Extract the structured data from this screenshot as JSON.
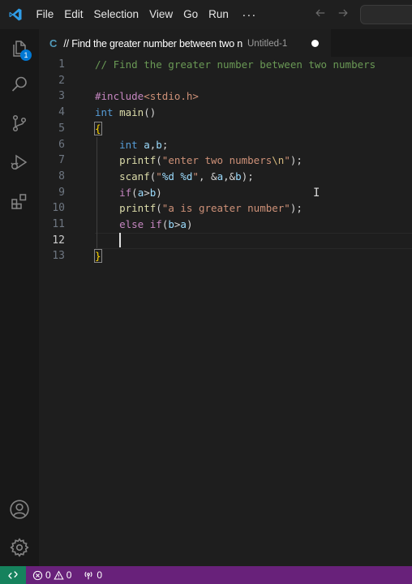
{
  "menu": {
    "items": [
      "File",
      "Edit",
      "Selection",
      "View",
      "Go",
      "Run"
    ],
    "more": "···"
  },
  "activity": {
    "explorer_badge": "1"
  },
  "tab": {
    "lang": "C",
    "title": "// Find the greater number between two n",
    "description": "Untitled-1"
  },
  "editor": {
    "line_numbers": [
      "1",
      "2",
      "3",
      "4",
      "5",
      "6",
      "7",
      "8",
      "9",
      "10",
      "11",
      "12",
      "13"
    ],
    "active_line": 12,
    "lines": [
      [
        {
          "t": "// Find the greater number between two numbers",
          "c": "t-comment"
        }
      ],
      [],
      [
        {
          "t": "#include",
          "c": "t-pre"
        },
        {
          "t": "<stdio.h>",
          "c": "t-inc"
        }
      ],
      [
        {
          "t": "int",
          "c": "t-kw"
        },
        {
          "t": " ",
          "c": "t-plain"
        },
        {
          "t": "main",
          "c": "t-fn"
        },
        {
          "t": "()",
          "c": "t-plain"
        }
      ],
      [
        {
          "t": "{",
          "c": "t-brace t-brace-box"
        }
      ],
      [
        {
          "t": "    ",
          "c": "t-plain"
        },
        {
          "t": "int",
          "c": "t-kw"
        },
        {
          "t": " ",
          "c": "t-plain"
        },
        {
          "t": "a",
          "c": "t-var"
        },
        {
          "t": ",",
          "c": "t-plain"
        },
        {
          "t": "b",
          "c": "t-var"
        },
        {
          "t": ";",
          "c": "t-plain"
        }
      ],
      [
        {
          "t": "    ",
          "c": "t-plain"
        },
        {
          "t": "printf",
          "c": "t-fn"
        },
        {
          "t": "(",
          "c": "t-plain"
        },
        {
          "t": "\"enter two numbers",
          "c": "t-str"
        },
        {
          "t": "\\n",
          "c": "t-esc"
        },
        {
          "t": "\"",
          "c": "t-str"
        },
        {
          "t": ");",
          "c": "t-plain"
        }
      ],
      [
        {
          "t": "    ",
          "c": "t-plain"
        },
        {
          "t": "scanf",
          "c": "t-fn"
        },
        {
          "t": "(",
          "c": "t-plain"
        },
        {
          "t": "\"",
          "c": "t-str"
        },
        {
          "t": "%d %d",
          "c": "t-var"
        },
        {
          "t": "\"",
          "c": "t-str"
        },
        {
          "t": ", &",
          "c": "t-plain"
        },
        {
          "t": "a",
          "c": "t-var"
        },
        {
          "t": ",&",
          "c": "t-plain"
        },
        {
          "t": "b",
          "c": "t-var"
        },
        {
          "t": ");",
          "c": "t-plain"
        }
      ],
      [
        {
          "t": "    ",
          "c": "t-plain"
        },
        {
          "t": "if",
          "c": "t-ctrl"
        },
        {
          "t": "(",
          "c": "t-plain"
        },
        {
          "t": "a",
          "c": "t-var"
        },
        {
          "t": ">",
          "c": "t-plain"
        },
        {
          "t": "b",
          "c": "t-var"
        },
        {
          "t": ")",
          "c": "t-plain"
        }
      ],
      [
        {
          "t": "    ",
          "c": "t-plain"
        },
        {
          "t": "printf",
          "c": "t-fn"
        },
        {
          "t": "(",
          "c": "t-plain"
        },
        {
          "t": "\"a is greater number\"",
          "c": "t-str"
        },
        {
          "t": ");",
          "c": "t-plain"
        }
      ],
      [
        {
          "t": "    ",
          "c": "t-plain"
        },
        {
          "t": "else",
          "c": "t-ctrl"
        },
        {
          "t": " ",
          "c": "t-plain"
        },
        {
          "t": "if",
          "c": "t-ctrl"
        },
        {
          "t": "(",
          "c": "t-plain"
        },
        {
          "t": "b",
          "c": "t-var"
        },
        {
          "t": ">",
          "c": "t-plain"
        },
        {
          "t": "a",
          "c": "t-var"
        },
        {
          "t": ")",
          "c": "t-plain"
        }
      ],
      [
        {
          "t": "    ",
          "c": "t-plain"
        }
      ],
      [
        {
          "t": "}",
          "c": "t-brace t-brace-box"
        }
      ]
    ]
  },
  "status": {
    "errors": "0",
    "warnings": "0",
    "ports": "0"
  },
  "colors": {
    "status_bar": "#68217a",
    "remote": "#16825d",
    "badge": "#0078d4"
  }
}
